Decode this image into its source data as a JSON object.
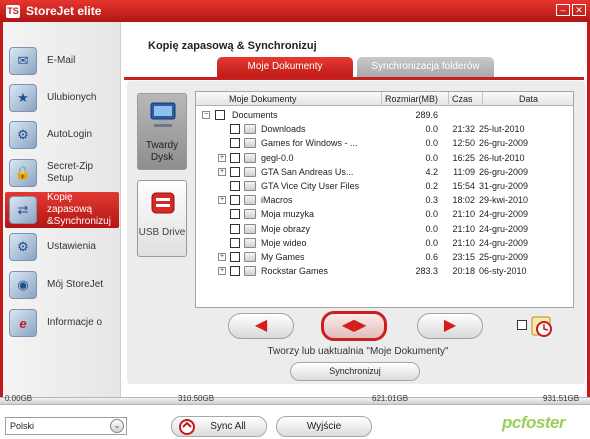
{
  "window": {
    "title": "StoreJet elite",
    "logo_text": "TS"
  },
  "sidebar": {
    "items": [
      {
        "label": "E-Mail",
        "icon": "email-icon",
        "glyph": "✉"
      },
      {
        "label": "Ulubionych",
        "icon": "favorites-icon",
        "glyph": "★"
      },
      {
        "label": "AutoLogin",
        "icon": "autologin-icon",
        "glyph": "⚙"
      },
      {
        "label": "Secret-Zip Setup",
        "icon": "secret-zip-icon",
        "glyph": "🔒"
      },
      {
        "label": "Kopię zapasową &Synchronizuj",
        "icon": "backup-sync-icon",
        "glyph": "⇄"
      },
      {
        "label": "Ustawienia",
        "icon": "settings-icon",
        "glyph": "⚙"
      },
      {
        "label": "Mój StoreJet",
        "icon": "my-storejet-icon",
        "glyph": "◉"
      },
      {
        "label": "Informacje o",
        "icon": "info-icon",
        "glyph": "e"
      }
    ]
  },
  "main": {
    "title": "Kopię zapasową & Synchronizuj",
    "tabs": [
      {
        "label": "Moje Dokumenty",
        "active": true
      },
      {
        "label": "Synchronizacja folderów",
        "active": false
      }
    ]
  },
  "devices": [
    {
      "label": "Twardy Dysk",
      "icon": "hard-disk-icon",
      "active": true
    },
    {
      "label": "USB Drive",
      "icon": "usb-drive-icon",
      "active": false
    }
  ],
  "table": {
    "headers": {
      "name": "Moje Dokumenty",
      "size": "Rozmiar(MB)",
      "time": "Czas",
      "date": "Data"
    },
    "root": {
      "name": "Documents",
      "size": "289.6",
      "time": "",
      "date": "",
      "expander": "−"
    },
    "rows": [
      {
        "name": "Downloads",
        "size": "0.0",
        "time": "21:32",
        "date": "25-lut-2010",
        "expandable": false
      },
      {
        "name": "Games for Windows - ...",
        "size": "0.0",
        "time": "12:50",
        "date": "26-gru-2009",
        "expandable": false
      },
      {
        "name": "gegl-0.0",
        "size": "0.0",
        "time": "16:25",
        "date": "26-lut-2010",
        "expandable": true
      },
      {
        "name": "GTA San Andreas Us...",
        "size": "4.2",
        "time": "11:09",
        "date": "26-gru-2009",
        "expandable": true
      },
      {
        "name": "GTA Vice City User Files",
        "size": "0.2",
        "time": "15:54",
        "date": "31-gru-2009",
        "expandable": false
      },
      {
        "name": "iMacros",
        "size": "0.3",
        "time": "18:02",
        "date": "29-kwi-2010",
        "expandable": true
      },
      {
        "name": "Moja muzyka",
        "size": "0.0",
        "time": "21:10",
        "date": "24-gru-2009",
        "expandable": false
      },
      {
        "name": "Moje obrazy",
        "size": "0.0",
        "time": "21:10",
        "date": "24-gru-2009",
        "expandable": false
      },
      {
        "name": "Moje wideo",
        "size": "0.0",
        "time": "21:10",
        "date": "24-gru-2009",
        "expandable": false
      },
      {
        "name": "My Games",
        "size": "0.6",
        "time": "23:15",
        "date": "25-gru-2009",
        "expandable": true
      },
      {
        "name": "Rockstar Games",
        "size": "283.3",
        "time": "20:18",
        "date": "06-sty-2010",
        "expandable": true
      }
    ],
    "expand_glyph": "+"
  },
  "actions": {
    "message": "Tworzy lub uaktualnia \"Moje Dokumenty\"",
    "sync_label": "Synchronizuj",
    "left_glyph": "◀",
    "center_glyph": "◀▶",
    "right_glyph": "▶"
  },
  "capacity": {
    "labels": [
      "0.00GB",
      "310.50GB",
      "621.01GB",
      "931.51GB"
    ],
    "used_fraction": 0.0
  },
  "bottom": {
    "language": "Polski",
    "dropdown_glyph": "⌄",
    "sync_all": "Sync All",
    "exit": "Wyjście",
    "watermark": "pcfoster"
  },
  "colors": {
    "accent": "#c41a1a",
    "active_tab": "#d42724",
    "watermark": "#9bcf5c"
  }
}
